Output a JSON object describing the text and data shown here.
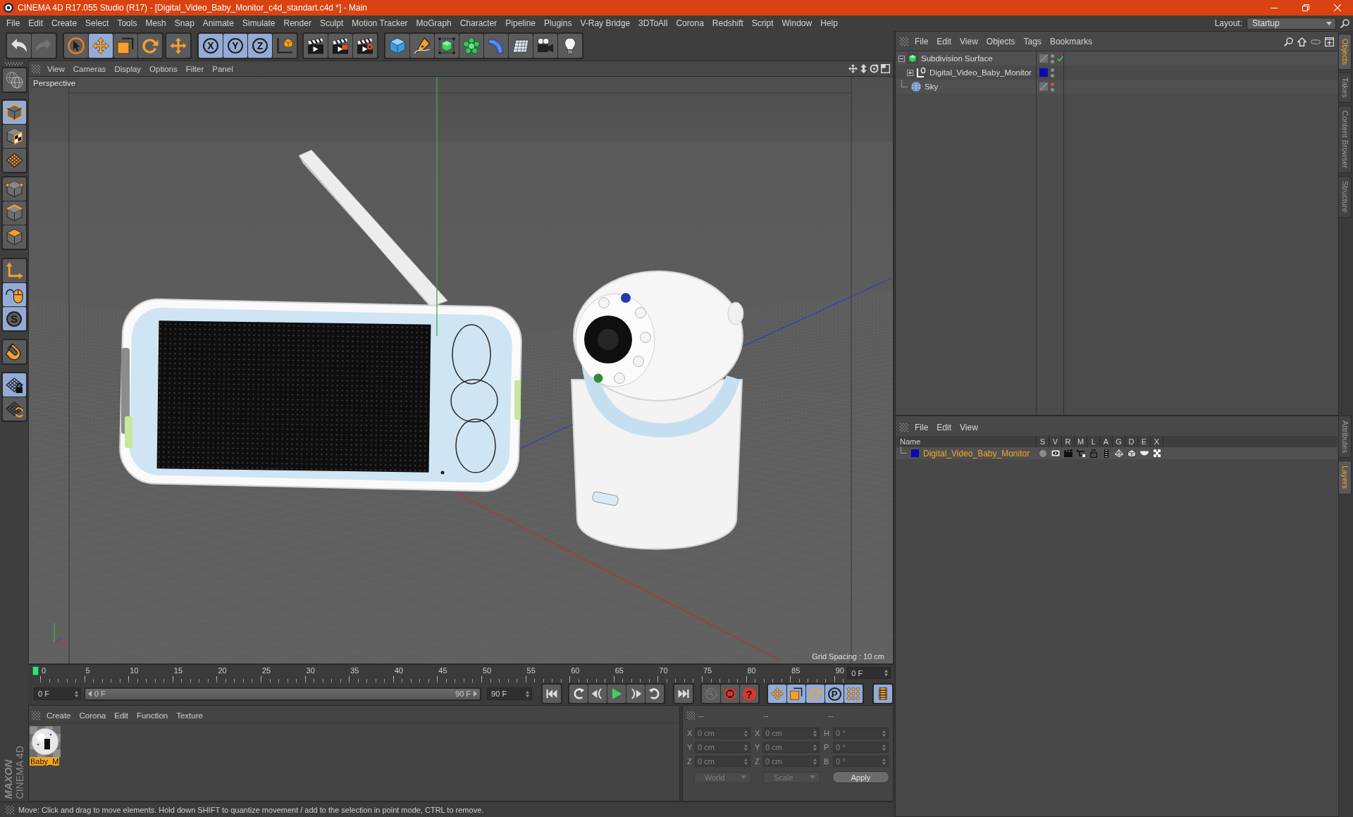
{
  "window": {
    "title": "CINEMA 4D R17.055 Studio (R17) - [Digital_Video_Baby_Monitor_c4d_standart.c4d *] - Main"
  },
  "menu_bar": {
    "items": [
      "File",
      "Edit",
      "Create",
      "Select",
      "Tools",
      "Mesh",
      "Snap",
      "Animate",
      "Simulate",
      "Render",
      "Sculpt",
      "Motion Tracker",
      "MoGraph",
      "Character",
      "Pipeline",
      "Plugins",
      "V-Ray Bridge",
      "3DToAll",
      "Corona",
      "Redshift",
      "Script",
      "Window",
      "Help"
    ],
    "layout_label": "Layout:",
    "layout_value": "Startup"
  },
  "toolbar": {
    "groups": [
      {
        "buttons": [
          {
            "kind": "undo",
            "selected": false,
            "disabled": false
          },
          {
            "kind": "redo",
            "selected": false,
            "disabled": true
          }
        ]
      },
      {
        "buttons": [
          {
            "kind": "select",
            "selected": false,
            "disabled": false
          },
          {
            "kind": "move",
            "selected": true,
            "disabled": false
          },
          {
            "kind": "scale",
            "selected": false,
            "disabled": false
          },
          {
            "kind": "rotate",
            "selected": false,
            "disabled": false
          }
        ]
      },
      {
        "buttons": [
          {
            "kind": "transform",
            "selected": false,
            "disabled": false
          }
        ]
      },
      {
        "buttons": [
          {
            "kind": "axis",
            "label": "X",
            "selected": true,
            "disabled": false
          },
          {
            "kind": "axis",
            "label": "Y",
            "selected": true,
            "disabled": false
          },
          {
            "kind": "axis",
            "label": "Z",
            "selected": true,
            "disabled": false
          },
          {
            "kind": "coordinate-system",
            "selected": false,
            "disabled": false
          }
        ]
      },
      {
        "buttons": [
          {
            "kind": "render-view",
            "selected": false,
            "disabled": false
          },
          {
            "kind": "render-picture-viewer",
            "selected": false,
            "disabled": false
          },
          {
            "kind": "render-settings",
            "selected": false,
            "disabled": false
          }
        ]
      },
      {
        "buttons": [
          {
            "kind": "cube",
            "selected": false,
            "disabled": false
          },
          {
            "kind": "pen",
            "selected": false,
            "disabled": false
          },
          {
            "kind": "subdivision",
            "selected": false,
            "disabled": false
          },
          {
            "kind": "cloner",
            "selected": false,
            "disabled": false
          },
          {
            "kind": "bend",
            "selected": false,
            "disabled": false
          },
          {
            "kind": "floor",
            "selected": false,
            "disabled": false
          },
          {
            "kind": "camera",
            "selected": false,
            "disabled": false
          },
          {
            "kind": "light",
            "selected": false,
            "disabled": false
          }
        ]
      }
    ]
  },
  "side_toolbar": {
    "groups": [
      {
        "buttons": [
          {
            "kind": "make-editable",
            "selected": false
          }
        ]
      },
      {
        "buttons": [
          {
            "kind": "model",
            "selected": true
          },
          {
            "kind": "texture",
            "selected": false
          },
          {
            "kind": "workplane",
            "selected": false
          }
        ]
      },
      {
        "buttons": [
          {
            "kind": "points",
            "selected": false
          },
          {
            "kind": "edges",
            "selected": false
          },
          {
            "kind": "polygons",
            "selected": false
          }
        ]
      },
      {
        "buttons": [
          {
            "kind": "axis-mode",
            "selected": false
          },
          {
            "kind": "tweak",
            "selected": true
          },
          {
            "kind": "solo",
            "label": "S",
            "selected": true
          }
        ]
      },
      {
        "buttons": [
          {
            "kind": "magnet",
            "selected": false
          }
        ]
      },
      {
        "buttons": [
          {
            "kind": "lock-workplane",
            "selected": true
          },
          {
            "kind": "planar-workplane",
            "selected": false
          }
        ]
      }
    ]
  },
  "logo": {
    "brand": "MAXON",
    "product": "CINEMA 4D"
  },
  "viewport": {
    "menu": [
      "View",
      "Cameras",
      "Display",
      "Options",
      "Filter",
      "Panel"
    ],
    "camera_label": "Perspective",
    "grid_info": "Grid Spacing : 10 cm"
  },
  "timeline": {
    "ticks": [
      "0",
      "5",
      "10",
      "15",
      "20",
      "25",
      "30",
      "35",
      "40",
      "45",
      "50",
      "55",
      "60",
      "65",
      "70",
      "75",
      "80",
      "85",
      "90"
    ],
    "current_frame": "0 F"
  },
  "transport": {
    "start_field": "0 F",
    "range": {
      "start": "0 F",
      "end": "90 F",
      "level": 1
    },
    "end_field": "90 F",
    "groups": [
      {
        "buttons": [
          {
            "kind": "go-start",
            "selected": false,
            "disabled": false
          }
        ]
      },
      {
        "buttons": [
          {
            "kind": "prev-key",
            "selected": false,
            "disabled": false
          },
          {
            "kind": "prev-frame",
            "selected": false,
            "disabled": false
          },
          {
            "kind": "play",
            "selected": false,
            "disabled": false
          },
          {
            "kind": "next-frame",
            "selected": false,
            "disabled": false
          },
          {
            "kind": "next-key",
            "selected": false,
            "disabled": false
          }
        ]
      },
      {
        "buttons": [
          {
            "kind": "go-end",
            "selected": false,
            "disabled": false
          }
        ]
      },
      {
        "buttons": [
          {
            "kind": "record-objects",
            "selected": false,
            "disabled": true
          },
          {
            "kind": "autokey",
            "selected": false,
            "disabled": false
          },
          {
            "kind": "keyframe-selection",
            "label": "?",
            "selected": false,
            "disabled": false
          }
        ]
      },
      {
        "buttons": [
          {
            "kind": "key-position",
            "selected": true,
            "disabled": false
          },
          {
            "kind": "key-scale",
            "selected": true,
            "disabled": false
          },
          {
            "kind": "key-rotation",
            "selected": true,
            "disabled": false
          },
          {
            "kind": "key-parameter",
            "label": "P",
            "selected": true,
            "disabled": false
          },
          {
            "kind": "key-points",
            "selected": true,
            "disabled": false
          }
        ]
      },
      {
        "buttons": [
          {
            "kind": "timeline-window",
            "selected": true,
            "disabled": false
          }
        ]
      }
    ]
  },
  "materials": {
    "menu": [
      "Create",
      "Corona",
      "Edit",
      "Function",
      "Texture"
    ],
    "items": [
      {
        "name": "Baby_M",
        "selected": true
      }
    ]
  },
  "coordinates": {
    "headers": [
      "--",
      "--",
      "--"
    ],
    "rows": [
      {
        "position_axis": "X",
        "position": "0 cm",
        "size_axis": "X",
        "size": "0 cm",
        "rotation_axis": "H",
        "rotation": "0 °"
      },
      {
        "position_axis": "Y",
        "position": "0 cm",
        "size_axis": "Y",
        "size": "0 cm",
        "rotation_axis": "P",
        "rotation": "0 °"
      },
      {
        "position_axis": "Z",
        "position": "0 cm",
        "size_axis": "Z",
        "size": "0 cm",
        "rotation_axis": "B",
        "rotation": "0 °"
      }
    ],
    "mode": "World",
    "size_mode": "Scale",
    "apply": "Apply"
  },
  "status_bar": {
    "text": "Move: Click and drag to move elements. Hold down SHIFT to quantize movement / add to the selection in point mode, CTRL to remove."
  },
  "object_manager": {
    "menu": [
      "File",
      "Edit",
      "View",
      "Objects",
      "Tags",
      "Bookmarks"
    ],
    "tree": [
      {
        "name": "Subdivision Surface",
        "kind": "subdivision",
        "expanded": true,
        "editor_hidden": false,
        "render_hidden": false,
        "checkmark": true,
        "children": [
          {
            "name": "Digital_Video_Baby_Monitor",
            "kind": "null",
            "expanded": false,
            "color": "#0a0ab4",
            "editor_hidden": false,
            "render_hidden": false,
            "checkmark": false
          }
        ]
      },
      {
        "name": "Sky",
        "kind": "sky",
        "editor_hidden": true,
        "render_hidden": false,
        "checkmark": false
      }
    ]
  },
  "layers": {
    "menu": [
      "File",
      "Edit",
      "View"
    ],
    "columns": [
      "Name",
      "S",
      "V",
      "R",
      "M",
      "L",
      "A",
      "G",
      "D",
      "E",
      "X"
    ],
    "rows": [
      {
        "name": "Digital_Video_Baby_Monitor",
        "color": "#0a0ab4",
        "selected": true
      }
    ]
  },
  "side_tabs": {
    "top": [
      {
        "label": "Objects",
        "selected": true
      },
      {
        "label": "Takes",
        "selected": false
      },
      {
        "label": "Content Browser",
        "selected": false
      },
      {
        "label": "Structure",
        "selected": false
      }
    ],
    "bottom": [
      {
        "label": "Attributes",
        "selected": false
      },
      {
        "label": "Layers",
        "selected": true
      }
    ]
  }
}
